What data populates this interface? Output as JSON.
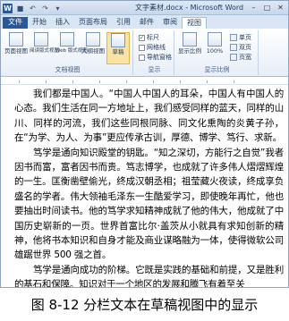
{
  "titlebar": {
    "title": "文字素材.docx - Microsoft Word",
    "logo": "W",
    "quick_access": [
      "save-icon",
      "undo-icon",
      "redo-icon",
      "customize-icon"
    ],
    "window_controls": [
      "minimize-icon",
      "maximize-icon",
      "close-icon"
    ]
  },
  "tabs": [
    {
      "label": "文件",
      "active": false
    },
    {
      "label": "开始",
      "active": false
    },
    {
      "label": "插入",
      "active": false
    },
    {
      "label": "页面布局",
      "active": false
    },
    {
      "label": "引用",
      "active": false
    },
    {
      "label": "邮件",
      "active": false
    },
    {
      "label": "审阅",
      "active": false
    },
    {
      "label": "视图",
      "active": true
    }
  ],
  "ribbon": {
    "views_group": {
      "label": "文档视图",
      "buttons": [
        {
          "label": "页面视图",
          "selected": false
        },
        {
          "label": "阅读版式视图",
          "selected": false
        },
        {
          "label": "Web 版式视图",
          "selected": false
        },
        {
          "label": "大纲视图",
          "selected": false
        },
        {
          "label": "草稿",
          "selected": true
        }
      ]
    },
    "show_group": {
      "label": "显示",
      "items": [
        {
          "label": "标尺",
          "checked": true
        },
        {
          "label": "网格线",
          "checked": false
        },
        {
          "label": "导航窗格",
          "checked": false
        }
      ]
    },
    "zoom_group": {
      "label": "显示比例",
      "buttons": [
        {
          "label": "显示比例"
        },
        {
          "label": "100%"
        }
      ],
      "small_buttons": [
        {
          "label": "单页"
        },
        {
          "label": "双页"
        },
        {
          "label": "页宽"
        }
      ]
    }
  },
  "document": {
    "paragraphs": [
      "我们都是中国人。“中国人中国人的耳朵，中国人有中国人的心态。我们生活在同一方地址上，我们感受同样的蓝天，同样的山川、同样的河流，我们这些同根同脉、同文化熏陶的炎黄子孙，在“为学、为人、为事”更应传承古训，厚德、博学、笃行、求新。",
      "笃学是通向知识殿堂的钥匙。“知之深切，方能行之自觉”我者因书而富，富者因书而贵。笃志博学，也成就了许多伟人熠熠辉煌的一生。匡衡凿壁偷光，终成汉朝丞相；祖莹藏火夜读，终成享负盛名的学者。伟大领袖毛泽东一生酷爱学习，即使晚年再忙，他也要抽出时间读书。他的笃学求知精神成就了他的伟大，他成就了中国历史崭新的一页。世界首富比尔·盖茨从小就具有求知创新的精神，他将书本知识和自身才能及商业谋略融为一体，使得微软公司雄踞世界 500 强之首。",
      "笃学是通向成功的阶梯。它既是实践的基础和前提，又是胜利的基石和保障。知识对于一个地区的发展和腾飞有着至关"
    ]
  },
  "caption": "图 8-12 分栏文本在草稿视图中的显示",
  "colors": {
    "accent": "#2b579a",
    "selected_button": "#fbe3a3",
    "ribbon_border": "#a9bfd6"
  }
}
